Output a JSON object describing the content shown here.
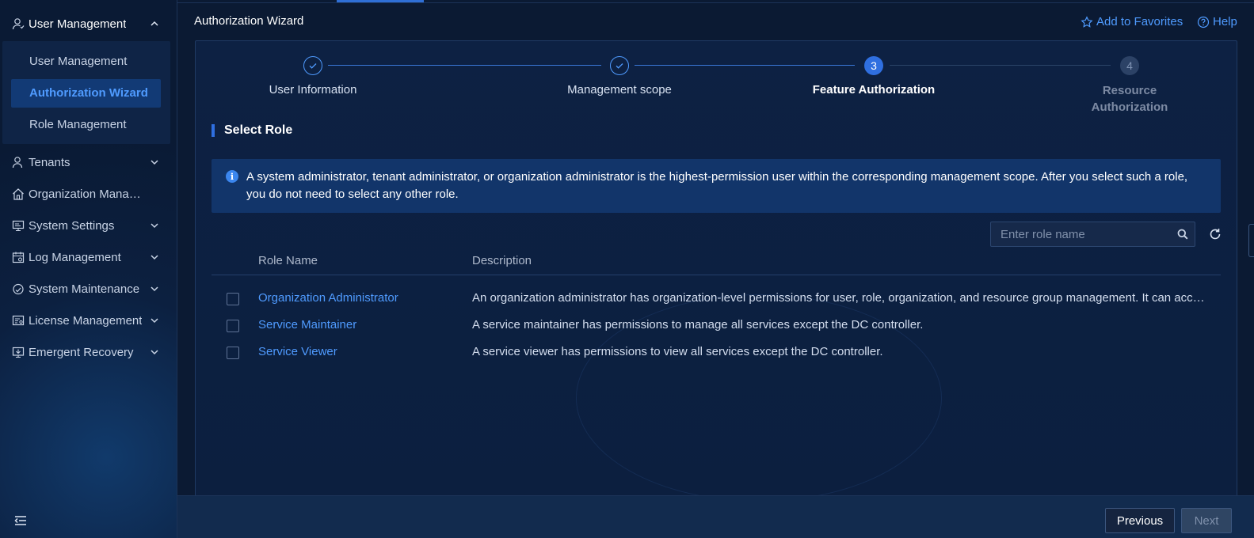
{
  "sidebar": {
    "groups": [
      {
        "label": "User Management",
        "icon": "user-icon",
        "expanded": true
      },
      {
        "label": "Tenants",
        "icon": "tenant-icon"
      },
      {
        "label": "Organization Management",
        "icon": "home-icon"
      },
      {
        "label": "System Settings",
        "icon": "monitor-icon"
      },
      {
        "label": "Log Management",
        "icon": "calendar-icon"
      },
      {
        "label": "System Maintenance",
        "icon": "maintenance-icon"
      },
      {
        "label": "License Management",
        "icon": "license-icon"
      },
      {
        "label": "Emergent Recovery",
        "icon": "recovery-icon"
      }
    ],
    "sub_items": [
      {
        "label": "User Management"
      },
      {
        "label": "Authorization Wizard",
        "active": true
      },
      {
        "label": "Role Management"
      }
    ]
  },
  "header": {
    "title": "Authorization Wizard",
    "favorites": "Add to Favorites",
    "help": "Help"
  },
  "steps": [
    {
      "number": "1",
      "label": "User Information",
      "status": "done"
    },
    {
      "number": "2",
      "label": "Management scope",
      "status": "done"
    },
    {
      "number": "3",
      "label": "Feature Authorization",
      "status": "current"
    },
    {
      "number": "4",
      "label": "Resource Authorization",
      "status": "todo"
    }
  ],
  "section": {
    "title": "Select Role",
    "info": "A system administrator, tenant administrator, or organization administrator is the highest-permission user within the corresponding management scope. After you select such a role, you do not need to select any other role."
  },
  "search": {
    "placeholder": "Enter role name",
    "value": ""
  },
  "table": {
    "columns": [
      "Role Name",
      "Description"
    ],
    "rows": [
      {
        "name": "Organization Administrator",
        "description": "An organization administrator has organization-level permissions for user, role, organization, and resource group management. It can access all services.",
        "checked": false
      },
      {
        "name": "Service Maintainer",
        "description": "A service maintainer has permissions to manage all services except the DC controller.",
        "checked": false
      },
      {
        "name": "Service Viewer",
        "description": "A service viewer has permissions to view all services except the DC controller.",
        "checked": false
      }
    ]
  },
  "footer": {
    "previous": "Previous",
    "next": "Next",
    "next_disabled": true
  },
  "colors": {
    "accent": "#2f6fe0",
    "link": "#4f9bff",
    "background": "#0b1a33"
  }
}
